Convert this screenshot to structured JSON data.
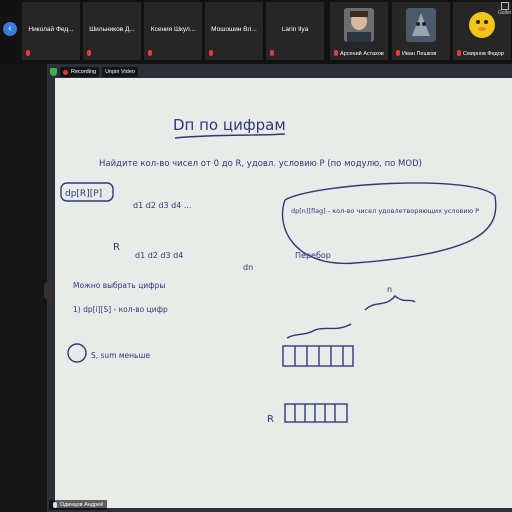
{
  "participants": [
    {
      "name": "Николай Фед...",
      "muted": true
    },
    {
      "name": "Шильников Д...",
      "muted": true
    },
    {
      "name": "Ксения Шкул...",
      "muted": true
    },
    {
      "name": "Мошошин Вл...",
      "muted": true
    },
    {
      "name": "Larin Ilya",
      "muted": true
    },
    {
      "name": "Арсений Астахов",
      "muted": true
    },
    {
      "name": "Иван Пешков",
      "muted": true
    },
    {
      "name": "Смирнов Федор",
      "muted": true
    }
  ],
  "gallery_label": "Galler",
  "recording_label": "Recording",
  "pin_label": "Unpin Video",
  "speaker_name": "Одинцов Андрей",
  "whiteboard_text": {
    "title": "Dп по цифрам",
    "task": "Найдите кол-во чисел от 0 до R, удовл. условию P (по модулю, по MOD)",
    "dp_label": "dp[R][P]",
    "seq": "d1 d2 d3 d4 ...",
    "R": "R",
    "digits": "d1 d2 d3 d4",
    "dn": "dn",
    "perebor": "Перебор",
    "dp_def": "dp[n][flag] - кол-во чисел удовлетворяющих условию P",
    "note1": "Можно выбрать цифры",
    "item1": "1) dp[i][S] - кол-во цифр",
    "item2": "S, sum меньше",
    "n_label": "n",
    "R_bottom": "R"
  }
}
